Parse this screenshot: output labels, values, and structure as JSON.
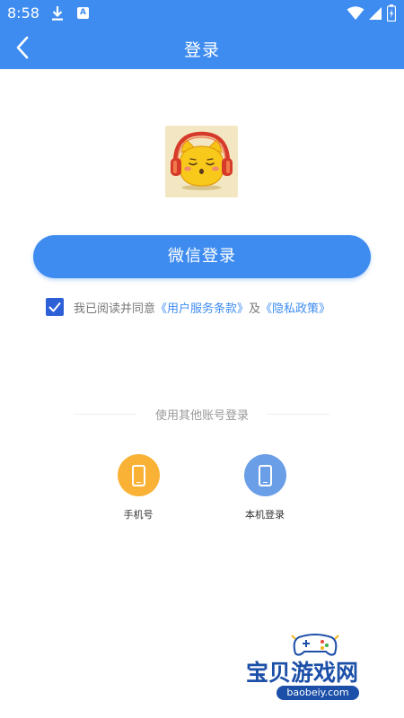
{
  "status_bar": {
    "time": "8:58",
    "a_badge": "A",
    "icons": [
      "download-icon",
      "app-notification-icon",
      "wifi-icon",
      "signal-icon",
      "battery-icon"
    ]
  },
  "header": {
    "title": "登录",
    "back_icon": "chevron-left-icon"
  },
  "logo": {
    "icon": "headphone-cat-mascot"
  },
  "wechat_login": {
    "label": "微信登录"
  },
  "agreement": {
    "checked": true,
    "prefix": "我已阅读并同意",
    "terms_link": "《用户服务条款》",
    "conjunction": "及",
    "privacy_link": "《隐私政策》"
  },
  "other_login": {
    "title": "使用其他账号登录",
    "options": [
      {
        "label": "手机号",
        "icon": "phone-icon",
        "color": "#f9b235"
      },
      {
        "label": "本机登录",
        "icon": "phone-icon",
        "color": "#6a9ee6"
      }
    ]
  },
  "watermark": {
    "text": "宝贝游戏网",
    "url": "baobeiy.com"
  },
  "colors": {
    "primary": "#3f8cf0",
    "checkbox": "#2d5fd6",
    "link": "#3f8cf0",
    "watermark": "#1c4fa8"
  }
}
